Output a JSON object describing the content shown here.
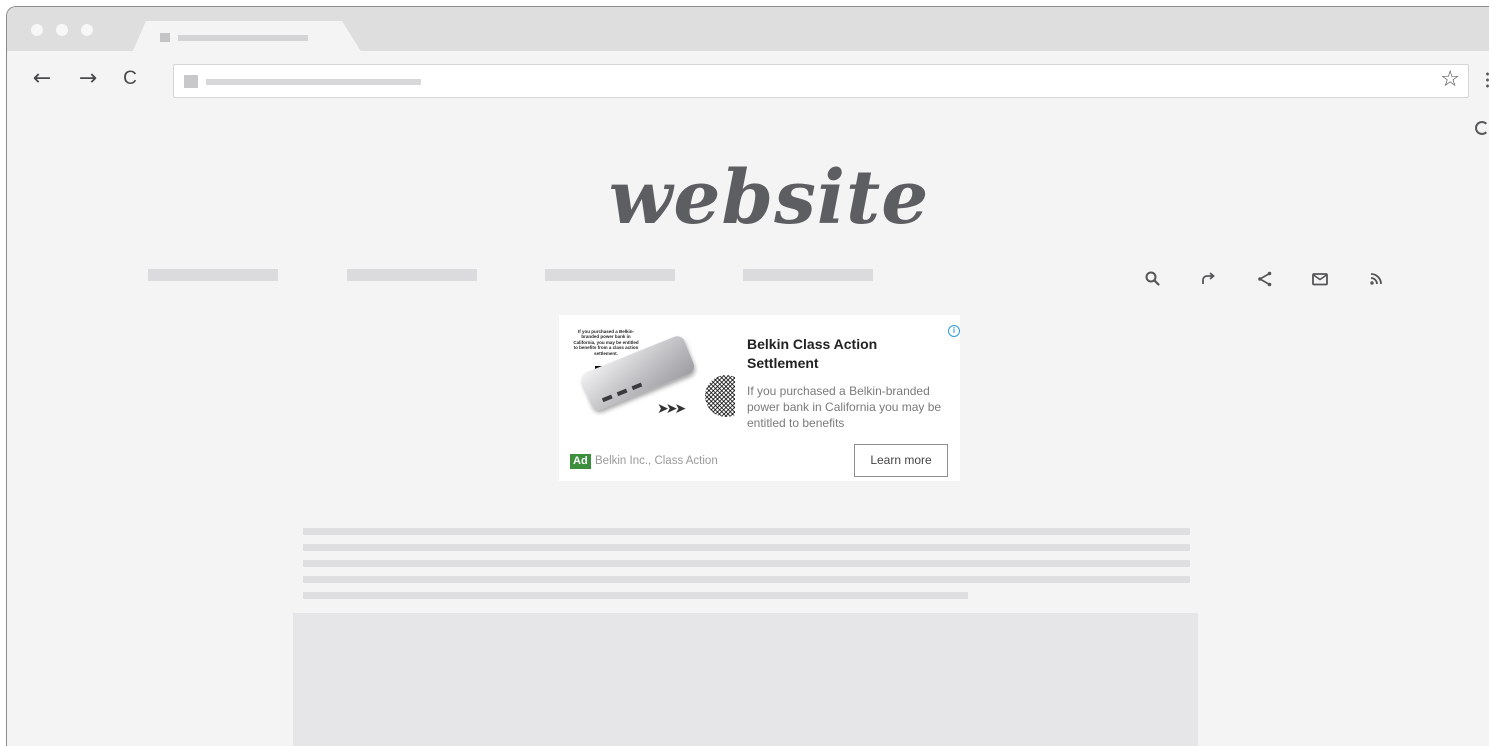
{
  "browser": {
    "window_controls": [
      "close",
      "minimize",
      "maximize"
    ],
    "nav": {
      "back_icon": "←",
      "forward_icon": "→",
      "reload_icon": "C"
    },
    "bookmark_icon": "☆"
  },
  "site": {
    "logo": "website",
    "tool_icons": [
      "search-icon",
      "reply-icon",
      "share-icon",
      "mail-icon",
      "rss-icon"
    ]
  },
  "ad": {
    "image_text": "If you purchased a Belkin-branded power bank in California, you may be entitled to benefits from a class action settlement.",
    "title": "Belkin Class Action Settlement",
    "description": "If you purchased a Belkin-branded power bank in California you may be entitled to benefits",
    "badge": "Ad",
    "advertiser": "Belkin Inc., Class Action",
    "cta": "Learn more",
    "info_icon": "i",
    "colors": {
      "badge": "#3c8f3c",
      "info": "#2a9fd8"
    }
  }
}
